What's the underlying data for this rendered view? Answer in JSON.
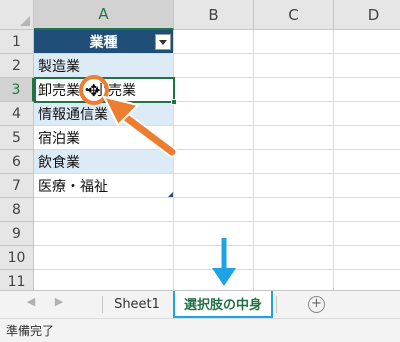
{
  "colors": {
    "accent_green": "#217346",
    "table_header_bg": "#1f4e79",
    "band_fill": "#ddebf7",
    "annotation_orange": "#ed7d31",
    "annotation_blue": "#1ea3e6"
  },
  "grid": {
    "columns": [
      "A",
      "B",
      "C",
      "D"
    ],
    "rows": [
      "1",
      "2",
      "3",
      "4",
      "5",
      "6",
      "7",
      "8",
      "9",
      "10",
      "11"
    ]
  },
  "table": {
    "header": "業種",
    "rows": [
      "製造業",
      "卸売業・小売業",
      "情報通信業",
      "宿泊業",
      "飲食業",
      "医療・福祉"
    ]
  },
  "selection": {
    "active_cell": "A3"
  },
  "sheet_tabs": {
    "nav_prev_icon": "◀",
    "nav_next_icon": "▶",
    "tabs": [
      "Sheet1",
      "選択肢の中身"
    ],
    "active_tab": "選択肢の中身",
    "add_icon": "+"
  },
  "cursor": {
    "glyph": "✥"
  },
  "status": {
    "text": "準備完了"
  }
}
